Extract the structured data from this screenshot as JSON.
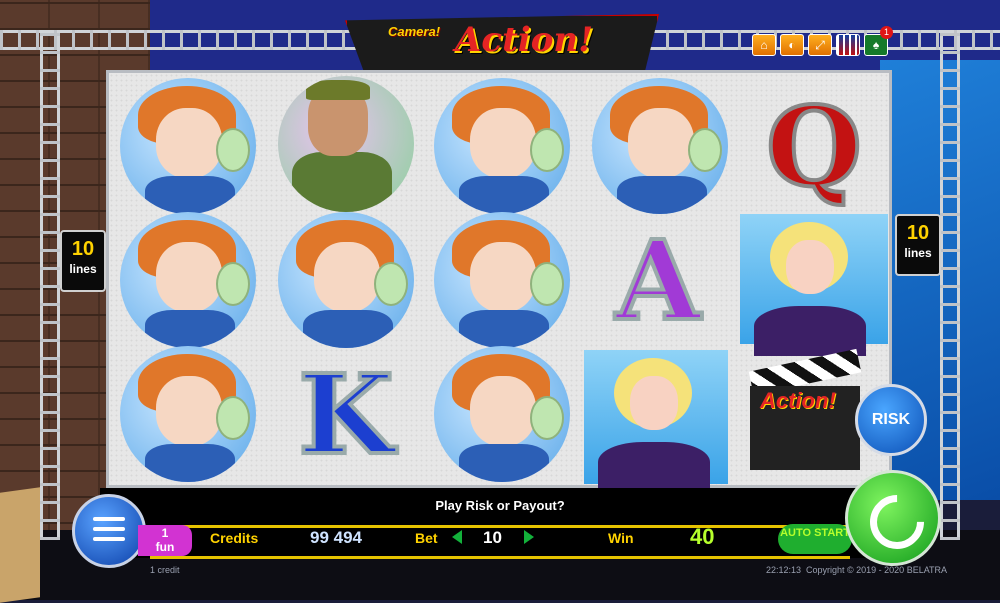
{
  "game": {
    "logo_small": "Camera!",
    "logo_big": "Action!",
    "badge_count": "1"
  },
  "top_icons": [
    "home-icon",
    "sound-icon",
    "fullscreen-icon",
    "uk-flag-icon",
    "spade-icon"
  ],
  "lines_left": {
    "number": "10",
    "label": "lines"
  },
  "lines_right": {
    "number": "10",
    "label": "lines"
  },
  "reels": [
    [
      "lady",
      "lady",
      "lady"
    ],
    [
      "man",
      "lady",
      "K"
    ],
    [
      "lady",
      "lady",
      "lady"
    ],
    [
      "lady",
      "A",
      "blonde"
    ],
    [
      "Q",
      "blonde",
      "clapper"
    ]
  ],
  "clapper_word": "Action!",
  "risk_label": "RISK",
  "message": "Play Risk or Payout?",
  "bottom": {
    "fun_number": "1",
    "fun_label": "fun",
    "credits_label": "Credits",
    "credits_value": "99 494",
    "bet_label": "Bet",
    "bet_value": "10",
    "win_label": "Win",
    "win_value": "40",
    "auto_label": "AUTO START",
    "credit_note": "1 credit"
  },
  "footer": {
    "time": "22:12:13",
    "copyright": "Copyright © 2019 - 2020 BELATRA"
  },
  "colors": {
    "accent_yellow": "#ffd200",
    "win_green": "#b6ff2c",
    "fun_pink": "#d233d2",
    "logo_red": "#e52424"
  }
}
